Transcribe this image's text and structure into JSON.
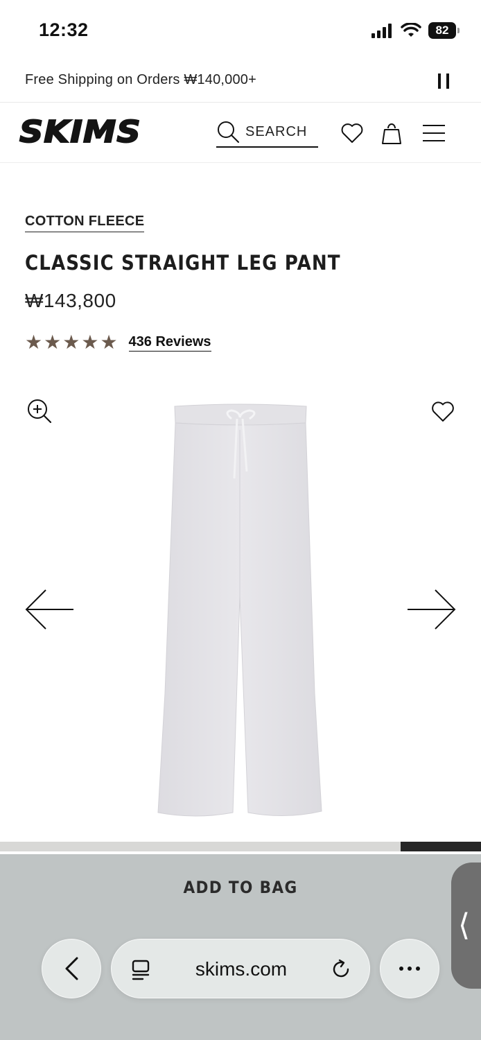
{
  "status_bar": {
    "time": "12:32",
    "battery": "82"
  },
  "promo": {
    "text": "Free Shipping on Orders ₩140,000+"
  },
  "header": {
    "logo": "SKIMS",
    "search_label": "SEARCH"
  },
  "product": {
    "collection": "COTTON FLEECE",
    "title": "CLASSIC STRAIGHT LEG PANT",
    "price": "₩143,800",
    "rating_stars": 5,
    "reviews_label": "436 Reviews"
  },
  "gallery": {
    "image_color": "#e4e3e6"
  },
  "cta": {
    "add_to_bag": "ADD TO BAG"
  },
  "browser": {
    "url": "skims.com"
  },
  "colors": {
    "star": "#6b5a4d",
    "panel": "#bfc4c4",
    "text": "#1a1a1a"
  }
}
